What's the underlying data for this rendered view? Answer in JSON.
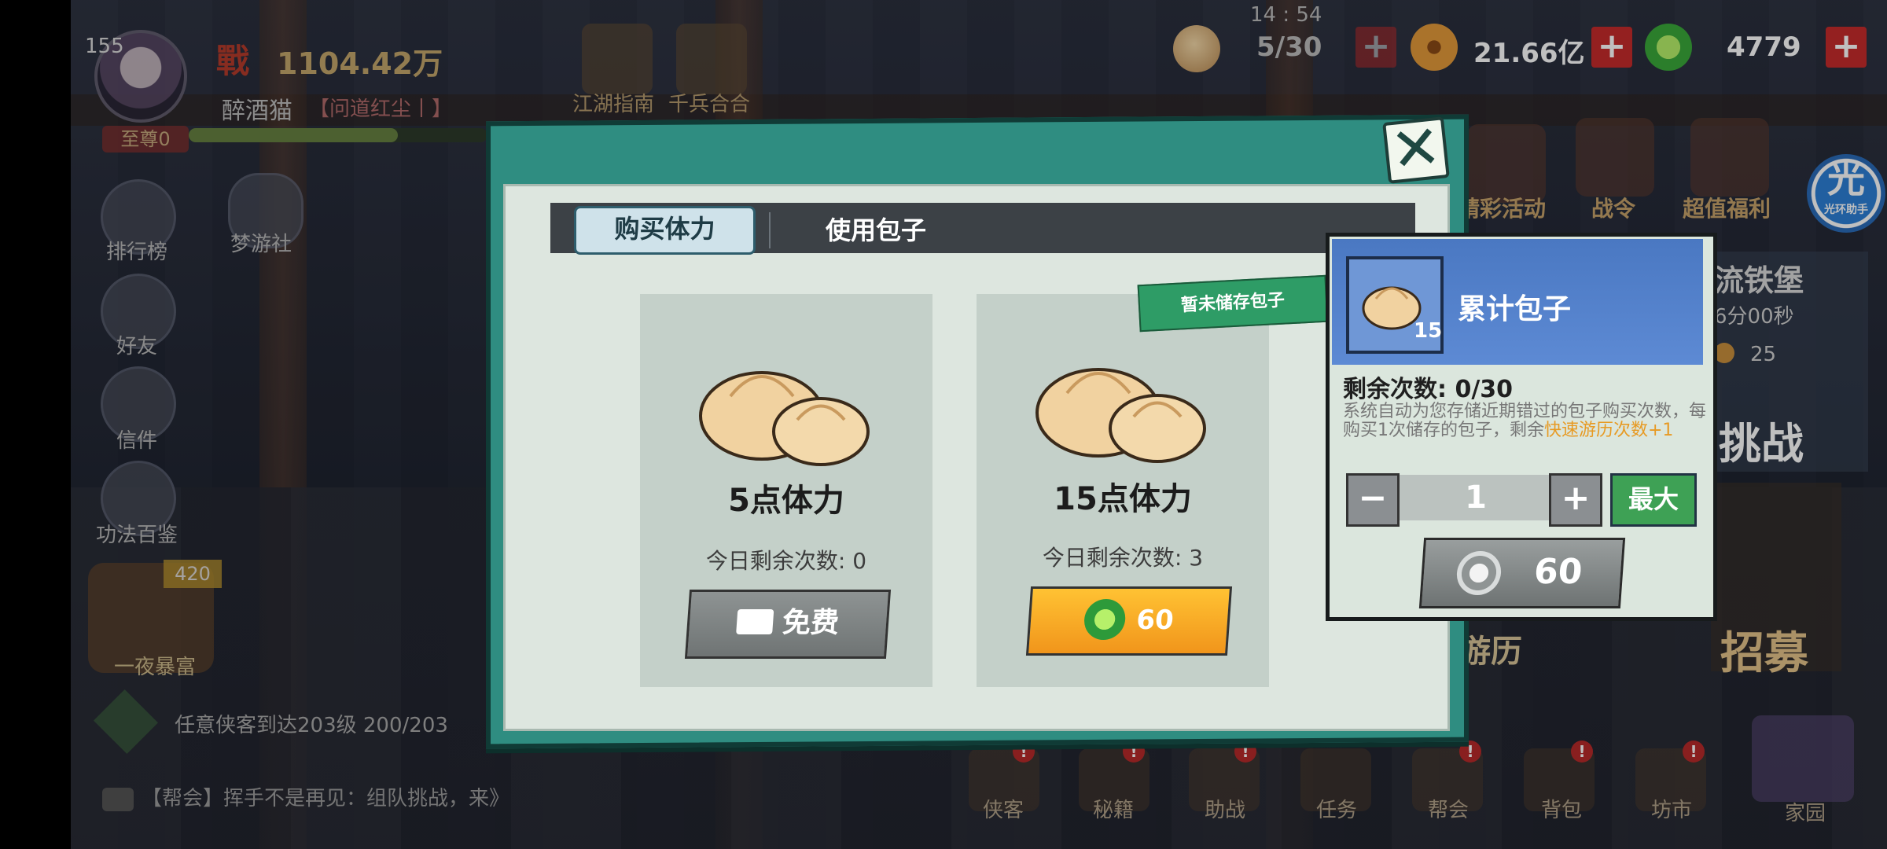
{
  "player": {
    "level": "155",
    "power": "1104.42万",
    "name": "醉酒猫",
    "title": "【问道红尘丨】",
    "vip": "至尊0"
  },
  "top_menu": [
    {
      "label": "江湖指南"
    },
    {
      "label": "千兵合合"
    }
  ],
  "clock": "14 : 54",
  "resources": {
    "stamina": "5/30",
    "coins": "21.66亿",
    "jade": "4779"
  },
  "side_menu": [
    {
      "label": "排行榜"
    },
    {
      "label": "梦游社"
    },
    {
      "label": "好友"
    },
    {
      "label": "信件"
    },
    {
      "label": "功法百鉴"
    }
  ],
  "fortune": {
    "badge": "420",
    "label": "一夜暴富"
  },
  "quest": "任意侠客到达203级 200/203",
  "chat": "【帮会】挥手不是再见：组队挑战，来》",
  "bottom_menu": [
    {
      "label": "侠客"
    },
    {
      "label": "秘籍"
    },
    {
      "label": "助战"
    },
    {
      "label": "任务"
    },
    {
      "label": "帮会"
    },
    {
      "label": "背包"
    },
    {
      "label": "坊市"
    },
    {
      "label": "家园"
    }
  ],
  "right_menu": [
    {
      "label": "精彩活动"
    },
    {
      "label": "战令"
    },
    {
      "label": "超值福利"
    }
  ],
  "right_scene": {
    "fort": "流铁堡",
    "timer": "6分00秒",
    "cost": "25",
    "challenge": "挑战",
    "travel": "游历",
    "recruit": "招募"
  },
  "assistant": {
    "big": "光",
    "small": "光环助手"
  },
  "modal": {
    "tab_buy": "购买体力",
    "tab_use": "使用包子",
    "ribbon": "暂未储存包子",
    "cards": [
      {
        "title": "5点体力",
        "remaining": "今日剩余次数: 0",
        "button": "免费"
      },
      {
        "title": "15点体力",
        "remaining": "今日剩余次数: 3",
        "button": "60"
      }
    ]
  },
  "popover": {
    "title": "累计包子",
    "item_qty": "15",
    "remaining": "剩余次数:  0/30",
    "desc_plain": "系统自动为您存储近期错过的包子购买次数，每购买1次储存的包子，剩余",
    "desc_highlight": "快速游历次数+1",
    "quantity": "1",
    "max_label": "最大",
    "price": "60"
  },
  "colors": {
    "modal_frame": "#2f8d81",
    "orange_button": "#f7a82a",
    "popover_header": "#4f7fc8",
    "plus_button": "#c62b2b"
  }
}
